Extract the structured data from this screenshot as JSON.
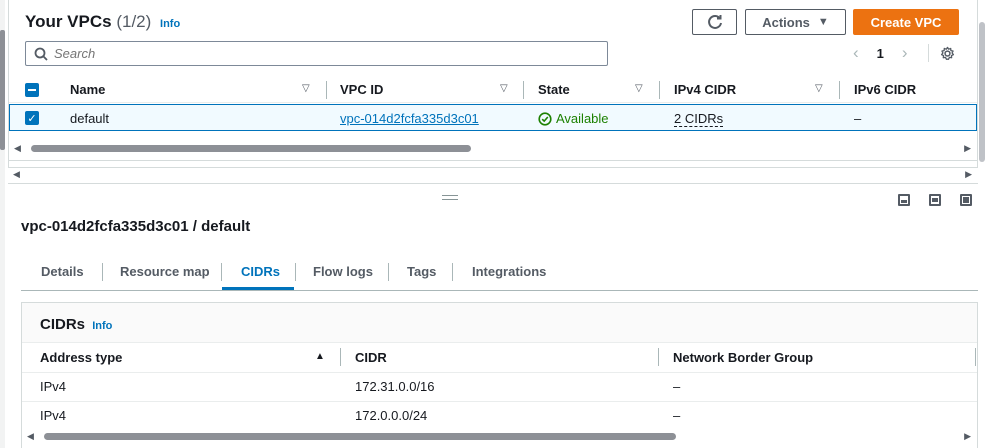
{
  "header": {
    "title": "Your VPCs",
    "count": "(1/2)",
    "info": "Info",
    "actions_label": "Actions",
    "create_label": "Create VPC"
  },
  "search": {
    "placeholder": "Search"
  },
  "pager": {
    "page": "1"
  },
  "vpc_table": {
    "columns": [
      "Name",
      "VPC ID",
      "State",
      "IPv4 CIDR",
      "IPv6 CIDR"
    ],
    "rows": [
      {
        "name": "default",
        "vpc_id": "vpc-014d2fcfa335d3c01",
        "state": "Available",
        "ipv4": "2 CIDRs",
        "ipv6": "–"
      }
    ]
  },
  "detail": {
    "title": "vpc-014d2fcfa335d3c01 / default",
    "tabs": [
      "Details",
      "Resource map",
      "CIDRs",
      "Flow logs",
      "Tags",
      "Integrations"
    ],
    "active_tab": "CIDRs"
  },
  "cidrs": {
    "title": "CIDRs",
    "info": "Info",
    "columns": [
      "Address type",
      "CIDR",
      "Network Border Group"
    ],
    "rows": [
      {
        "type": "IPv4",
        "cidr": "172.31.0.0/16",
        "nbg": "–"
      },
      {
        "type": "IPv4",
        "cidr": "172.0.0.0/24",
        "nbg": "–"
      }
    ]
  },
  "colors": {
    "primary": "#ec7211",
    "link": "#0073bb",
    "success": "#1d8102"
  }
}
